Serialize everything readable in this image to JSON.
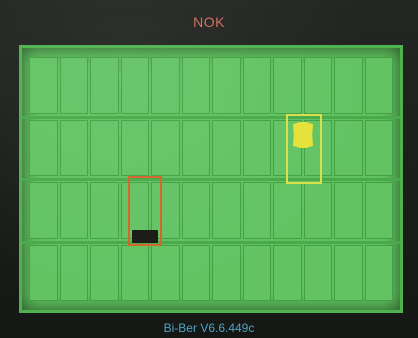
{
  "header": {
    "status": "NOK",
    "status_color": "#d56b5a"
  },
  "footer": {
    "version": "Bi-Ber V6.6.449c"
  },
  "inspection": {
    "tray_color": "#5fc25f",
    "rows": 4,
    "columns": 12,
    "markers": [
      {
        "name": "nok-inspection-box",
        "color": "#d3642a"
      },
      {
        "name": "ok-inspection-box",
        "color": "#d8e04a"
      }
    ]
  }
}
